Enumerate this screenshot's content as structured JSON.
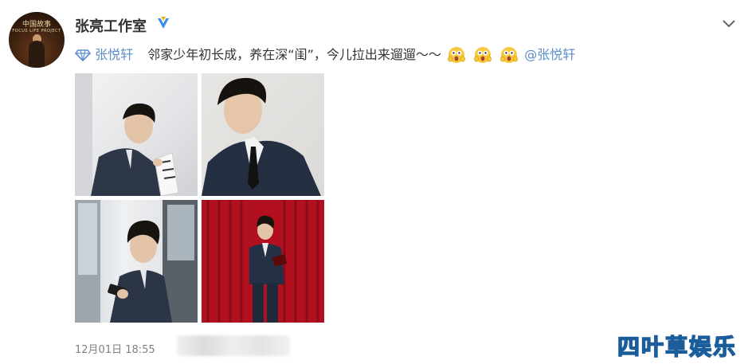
{
  "post": {
    "username": "张亮工作室",
    "avatar_title": "中国故事",
    "avatar_sub": "FOCUS LIFE PROJECT",
    "prefix_link": "张悦轩",
    "body_text": "邻家少年初长成，养在深“闺”，今儿拉出来遛遛～～",
    "emojis": [
      "surprised-face-icon",
      "surprised-face-icon",
      "surprised-face-icon"
    ],
    "mention": "@张悦轩",
    "time": "12月01日 18:55"
  },
  "watermark": "四叶草娱乐",
  "colors": {
    "link": "#5b8ec8",
    "verified": "#3a8ee6",
    "curtain": "#b3101f",
    "meta": "#808080"
  }
}
